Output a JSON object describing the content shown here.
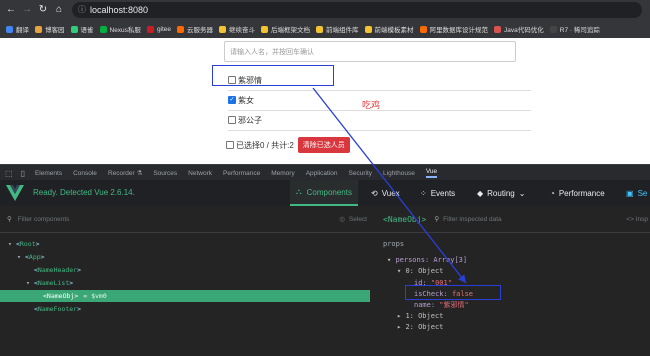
{
  "browser": {
    "url": "localhost:8080",
    "bookmarks": [
      {
        "label": "翻译",
        "color": "#4285f4"
      },
      {
        "label": "博客园",
        "color": "#e8a33d"
      },
      {
        "label": "语雀",
        "color": "#31cc79"
      },
      {
        "label": "Nexus私服",
        "color": "#00b140"
      },
      {
        "label": "gitee",
        "color": "#c71d23"
      },
      {
        "label": "云服务器",
        "color": "#ff6a00"
      },
      {
        "label": "继续奋斗",
        "color": "#f4c430"
      },
      {
        "label": "后端框架文档",
        "color": "#f4c430"
      },
      {
        "label": "前端组件库",
        "color": "#f4c430"
      },
      {
        "label": "前端模板素材",
        "color": "#f4c430"
      },
      {
        "label": "阿里数据库设计规范",
        "color": "#ff6a00"
      },
      {
        "label": "Java代码优化",
        "color": "#d9534f"
      },
      {
        "label": "R7 · 稀司追踪",
        "color": "#444444"
      }
    ]
  },
  "app": {
    "input_placeholder": "请输入人名，并按回车确认",
    "persons": [
      {
        "name": "紫邪情",
        "checked": false
      },
      {
        "name": "紫女",
        "checked": true
      },
      {
        "name": "邪公子",
        "checked": false
      }
    ],
    "footer_text": "已选择0 / 共计:2",
    "clear_button": "清除已选人员",
    "annotation": "吃鸡"
  },
  "devtools": {
    "tabs": [
      "Elements",
      "Console",
      "Recorder ⚗",
      "Sources",
      "Network",
      "Performance",
      "Memory",
      "Application",
      "Security",
      "Lighthouse",
      "Vue"
    ],
    "active_tab": "Vue",
    "vue_status": "Ready. Detected Vue 2.6.14.",
    "nav": {
      "components": "Components",
      "vuex": "Vuex",
      "events": "Events",
      "routing": "Routing",
      "performance": "Performance",
      "settings": "Se"
    },
    "left_filter": "Filter components",
    "select": "Select",
    "tree": [
      {
        "indent": 0,
        "toggle": "▾",
        "tag": "Root"
      },
      {
        "indent": 1,
        "toggle": "▾",
        "tag": "App"
      },
      {
        "indent": 2,
        "toggle": "",
        "tag": "NameHeader"
      },
      {
        "indent": 2,
        "toggle": "▾",
        "tag": "NameList"
      },
      {
        "indent": 3,
        "toggle": "",
        "tag": "NameObj",
        "suffix": "= $vm0",
        "selected": true
      },
      {
        "indent": 2,
        "toggle": "",
        "tag": "NameFooter"
      }
    ],
    "selected_component": "<NameObj>",
    "right_filter": "Filter inspected data",
    "inspect": "Insp",
    "props_label": "props",
    "props": {
      "persons_line": "persons: Array[3]",
      "obj0": "0: Object",
      "id_key": "id:",
      "id_val": "\"001\"",
      "ischeck_key": "isCheck:",
      "ischeck_val": "false",
      "name_key": "name:",
      "name_val": "\"紫邪情\"",
      "obj1": "1: Object",
      "obj2": "2: Object"
    }
  },
  "colors": {
    "vue_green": "#42b983",
    "highlight_blue": "#2a3fd8",
    "button_red": "#d9363e",
    "selected_row": "#3ba776"
  }
}
